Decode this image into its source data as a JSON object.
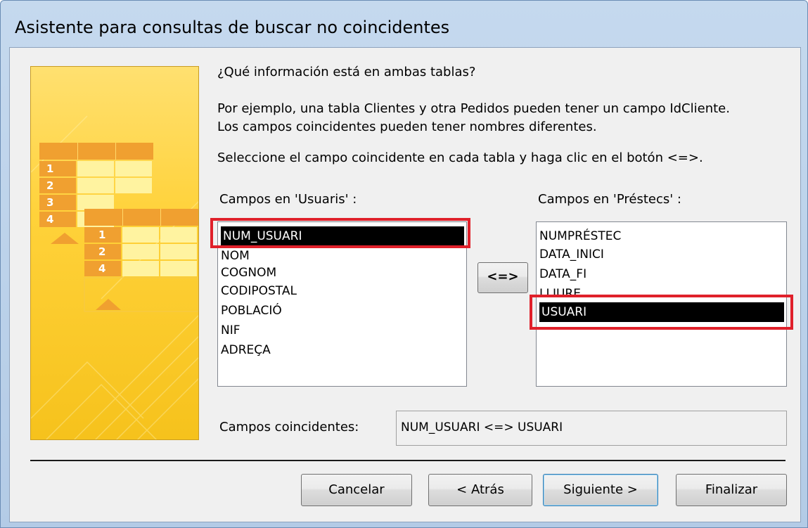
{
  "window": {
    "title": "Asistente para consultas de buscar no coincidentes"
  },
  "question": "¿Qué información está en ambas tablas?",
  "example_line1": "Por ejemplo, una tabla Clientes y otra Pedidos pueden tener un campo IdCliente.",
  "example_line2": "Los campos coincidentes pueden tener nombres diferentes.",
  "instruction": "Seleccione el campo coincidente en cada tabla y haga clic en el botón <=>.",
  "left_list": {
    "label": "Campos en 'Usuaris' :",
    "items": [
      "NUM_USUARI",
      "NOM",
      "COGNOM",
      "CODIPOSTAL",
      "POBLACIÓ",
      "NIF",
      "ADREÇA"
    ],
    "selected": "NUM_USUARI"
  },
  "right_list": {
    "label": "Campos en 'Préstecs' :",
    "items": [
      "NUMPRÉSTEC",
      "DATA_INICI",
      "DATA_FI",
      "LLIURE",
      "USUARI"
    ],
    "selected": "USUARI"
  },
  "match_button": "<=>",
  "matched": {
    "label": "Campos coincidentes:",
    "value": "NUM_USUARI <=> USUARI"
  },
  "buttons": {
    "cancel": "Cancelar",
    "back": "< Atrás",
    "next": "Siguiente >",
    "finish": "Finalizar"
  },
  "art_numbers": {
    "back_table": [
      "1",
      "2",
      "3",
      "4"
    ],
    "front_table": [
      "1",
      "2",
      "4"
    ]
  },
  "colors": {
    "highlight_box": "#e0202a",
    "selection": "#000000",
    "art_yellow": "#ffd23a",
    "art_orange": "#f0a030"
  }
}
